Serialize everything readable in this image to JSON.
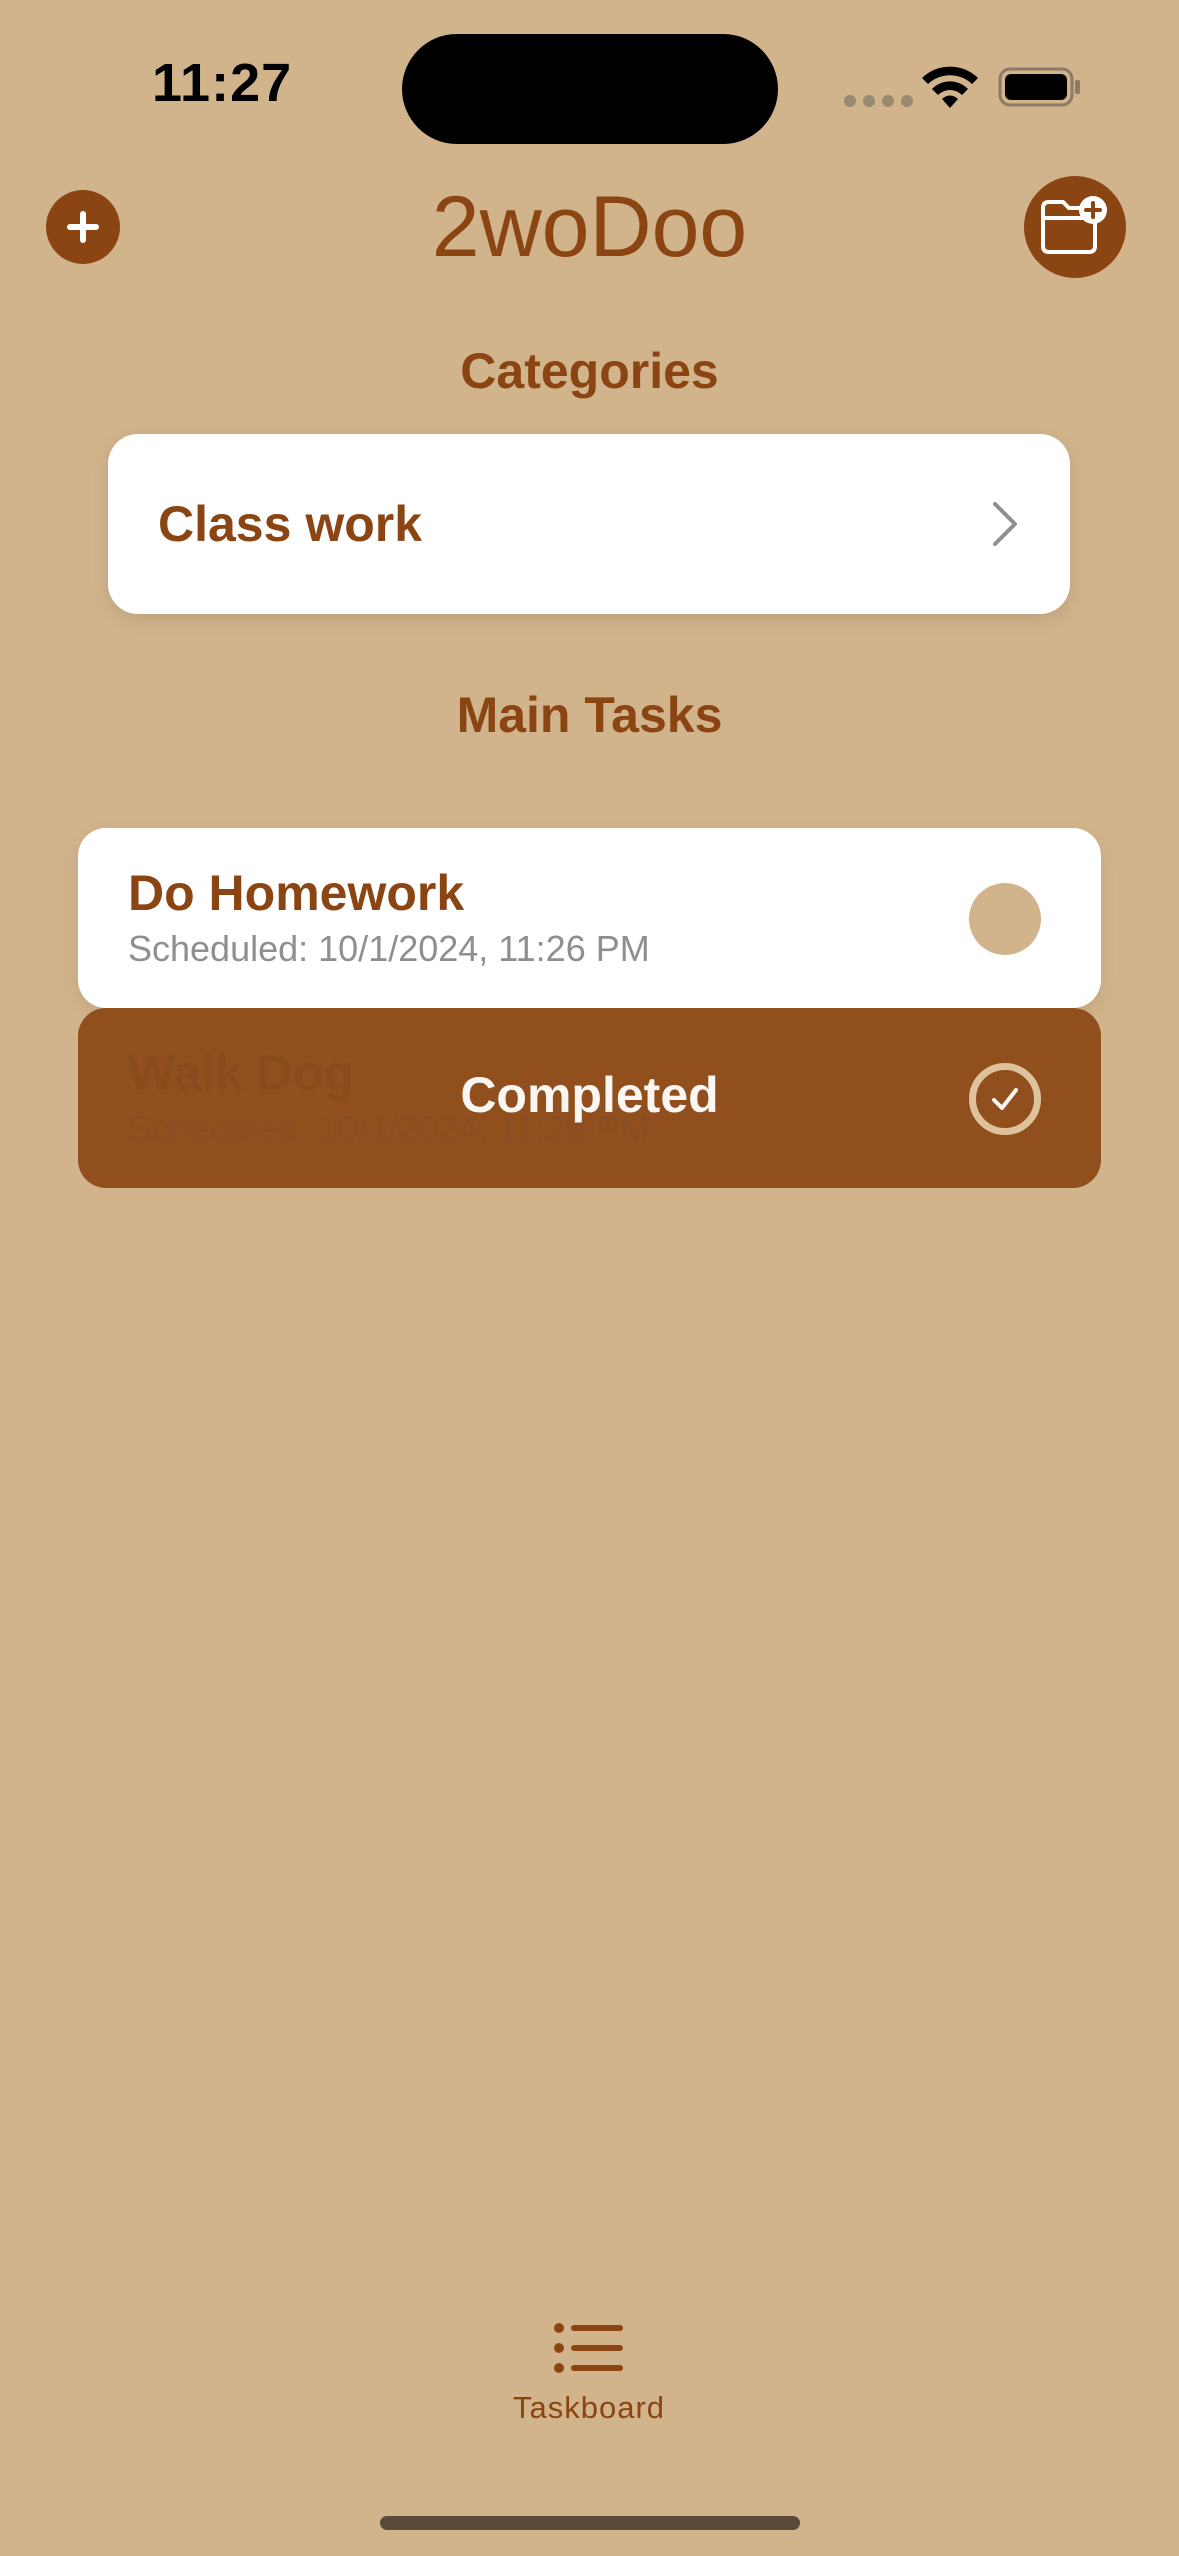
{
  "status_bar": {
    "time": "11:27"
  },
  "header": {
    "title": "2woDoo",
    "add_icon": "plus-circle-icon",
    "folder_icon": "folder-badge-plus-icon"
  },
  "categories": {
    "title": "Categories",
    "items": [
      {
        "label": "Class work"
      }
    ]
  },
  "tasks": {
    "title": "Main Tasks",
    "items": [
      {
        "title": "Do Homework",
        "scheduled": "Scheduled: 10/1/2024, 11:26 PM",
        "completed": false
      },
      {
        "title": "Walk Dog",
        "scheduled": "Scheduled: 10/1/2024, 11:26 PM",
        "completed": true,
        "overlay_label": "Completed"
      }
    ]
  },
  "tab_bar": {
    "items": [
      {
        "label": "Taskboard",
        "icon": "list-bullet-icon"
      }
    ]
  },
  "colors": {
    "background": "#D2B48C",
    "accent": "#8B4513",
    "card": "#FFFFFF"
  }
}
